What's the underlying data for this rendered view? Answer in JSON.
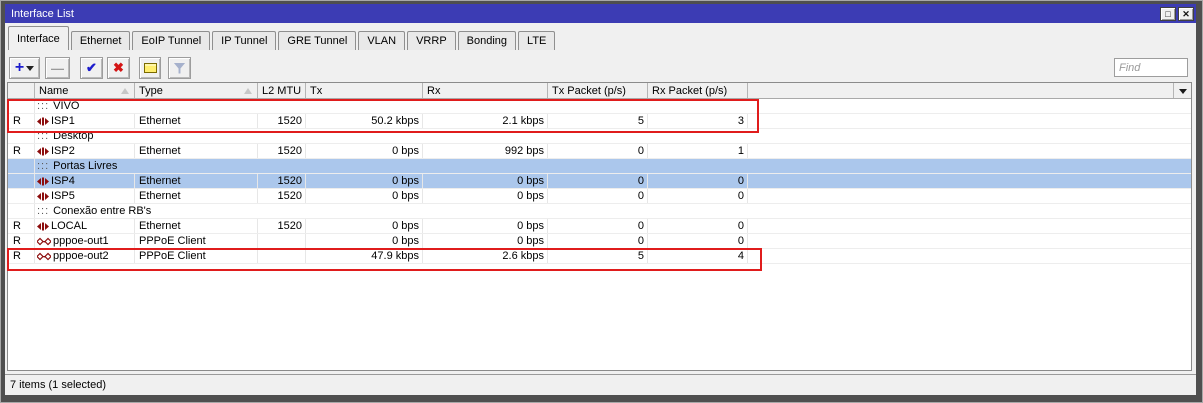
{
  "window": {
    "title": "Interface List",
    "controls": {
      "maximize": "□",
      "close": "✕"
    }
  },
  "tabs": [
    "Interface",
    "Ethernet",
    "EoIP Tunnel",
    "IP Tunnel",
    "GRE Tunnel",
    "VLAN",
    "VRRP",
    "Bonding",
    "LTE"
  ],
  "active_tab": "Interface",
  "toolbar": {
    "add_glyph": "+",
    "remove_glyph": "—",
    "enable_glyph": "✔",
    "disable_glyph": "✖",
    "comment_button": "comment",
    "filter_button": "filter",
    "find_placeholder": "Find"
  },
  "table": {
    "comment_prefix": ":::",
    "columns": [
      "",
      "Name",
      "Type",
      "L2 MTU",
      "Tx",
      "Rx",
      "Tx Packet (p/s)",
      "Rx Packet (p/s)"
    ],
    "sorted_columns": [
      "Name",
      "Type"
    ],
    "rows": [
      {
        "kind": "comment",
        "comment": "VIVO"
      },
      {
        "kind": "interface",
        "flag": "R",
        "icon": "ethernet",
        "name": "ISP1",
        "type": "Ethernet",
        "l2mtu": "1520",
        "tx": "50.2 kbps",
        "rx": "2.1 kbps",
        "tx_packet": "5",
        "rx_packet": "3"
      },
      {
        "kind": "comment",
        "comment": "Desktop"
      },
      {
        "kind": "interface",
        "flag": "R",
        "icon": "ethernet",
        "name": "ISP2",
        "type": "Ethernet",
        "l2mtu": "1520",
        "tx": "0 bps",
        "rx": "992 bps",
        "tx_packet": "0",
        "rx_packet": "1"
      },
      {
        "kind": "comment",
        "comment": "Portas Livres",
        "selected": true
      },
      {
        "kind": "interface",
        "flag": "",
        "icon": "ethernet",
        "name": "ISP4",
        "type": "Ethernet",
        "l2mtu": "1520",
        "tx": "0 bps",
        "rx": "0 bps",
        "tx_packet": "0",
        "rx_packet": "0",
        "selected": true
      },
      {
        "kind": "interface",
        "flag": "",
        "icon": "ethernet",
        "name": "ISP5",
        "type": "Ethernet",
        "l2mtu": "1520",
        "tx": "0 bps",
        "rx": "0 bps",
        "tx_packet": "0",
        "rx_packet": "0"
      },
      {
        "kind": "comment",
        "comment": "Conexão entre RB's"
      },
      {
        "kind": "interface",
        "flag": "R",
        "icon": "ethernet",
        "name": "LOCAL",
        "type": "Ethernet",
        "l2mtu": "1520",
        "tx": "0 bps",
        "rx": "0 bps",
        "tx_packet": "0",
        "rx_packet": "0"
      },
      {
        "kind": "interface",
        "flag": "R",
        "icon": "pppoe",
        "name": "pppoe-out1",
        "type": "PPPoE Client",
        "l2mtu": "",
        "tx": "0 bps",
        "rx": "0 bps",
        "tx_packet": "0",
        "rx_packet": "0"
      },
      {
        "kind": "interface",
        "flag": "R",
        "icon": "pppoe",
        "name": "pppoe-out2",
        "type": "PPPoE Client",
        "l2mtu": "",
        "tx": "47.9 kbps",
        "rx": "2.6 kbps",
        "tx_packet": "5",
        "rx_packet": "4"
      }
    ]
  },
  "status": "7 items (1 selected)",
  "colors": {
    "titlebar": "#3c3cb4",
    "selection": "#abc7ec",
    "annotation": "#e01c1c",
    "interface_icon": "#8c0d0d",
    "window_frame": "#4f4f4f"
  }
}
